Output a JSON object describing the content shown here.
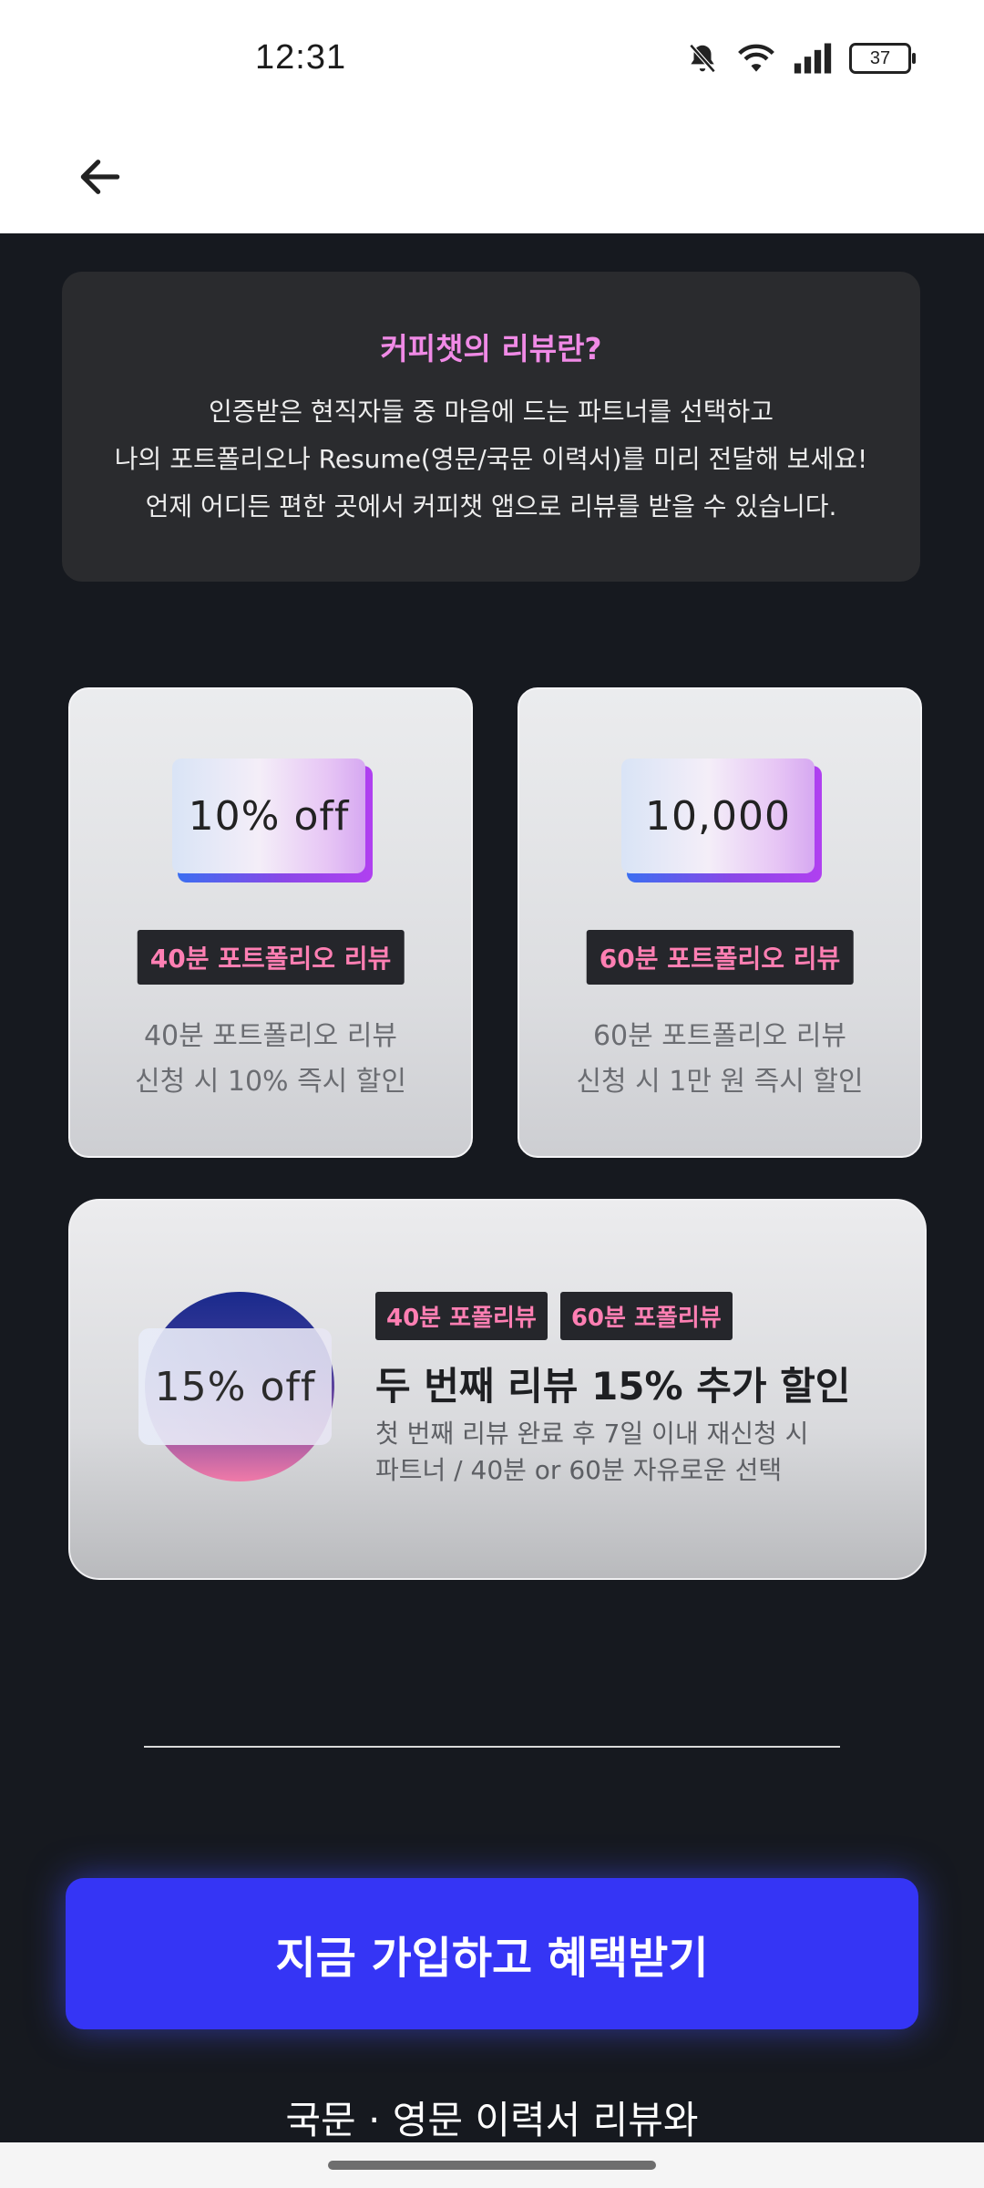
{
  "status_bar": {
    "time": "12:31",
    "battery": "37"
  },
  "intro": {
    "title": "커피챗의 리뷰란?",
    "line1": "인증받은 현직자들 중 마음에 드는 파트너를 선택하고",
    "line2": "나의 포트폴리오나 Resume(영문/국문 이력서)를 미리 전달해 보세요!",
    "line3": "언제 어디든 편한 곳에서 커피챗 앱으로 리뷰를 받을 수 있습니다."
  },
  "cards": [
    {
      "chip": "10% off",
      "tag": "40분 포트폴리오 리뷰",
      "desc_line1": "40분 포트폴리오 리뷰",
      "desc_line2": "신청 시 10% 즉시 할인"
    },
    {
      "chip": "10,000",
      "tag": "60분 포트폴리오 리뷰",
      "desc_line1": "60분 포트폴리오 리뷰",
      "desc_line2": "신청 시 1만 원 즉시 할인"
    }
  ],
  "wide_card": {
    "chip": "15% off",
    "tags": [
      "40분 포폴리뷰",
      "60분 포폴리뷰"
    ],
    "title": "두 번째 리뷰 15% 추가 할인",
    "desc_line1": "첫 번째 리뷰 완료 후 7일 이내 재신청 시",
    "desc_line2": "파트너 / 40분 or 60분 자유로운 선택"
  },
  "cta": {
    "label": "지금 가입하고 혜택받기"
  },
  "footer": {
    "text": "국문 · 영문 이력서 리뷰와"
  },
  "colors": {
    "accent": "#3535f5",
    "tag_text": "#ff7fb3",
    "title_pink": "#f08ae6",
    "background": "#16191f"
  },
  "icons": {
    "back": "arrow-left-icon"
  }
}
